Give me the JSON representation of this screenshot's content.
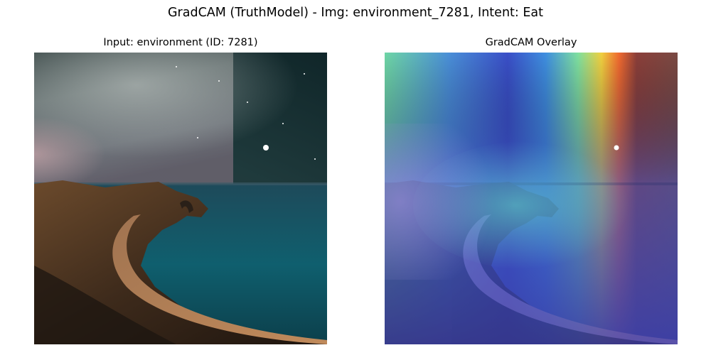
{
  "figure": {
    "suptitle": "GradCAM (TruthModel) - Img: environment_7281, Intent: Eat"
  },
  "panels": [
    {
      "title": "Input: environment (ID: 7281)"
    },
    {
      "title": "GradCAM Overlay"
    }
  ]
}
